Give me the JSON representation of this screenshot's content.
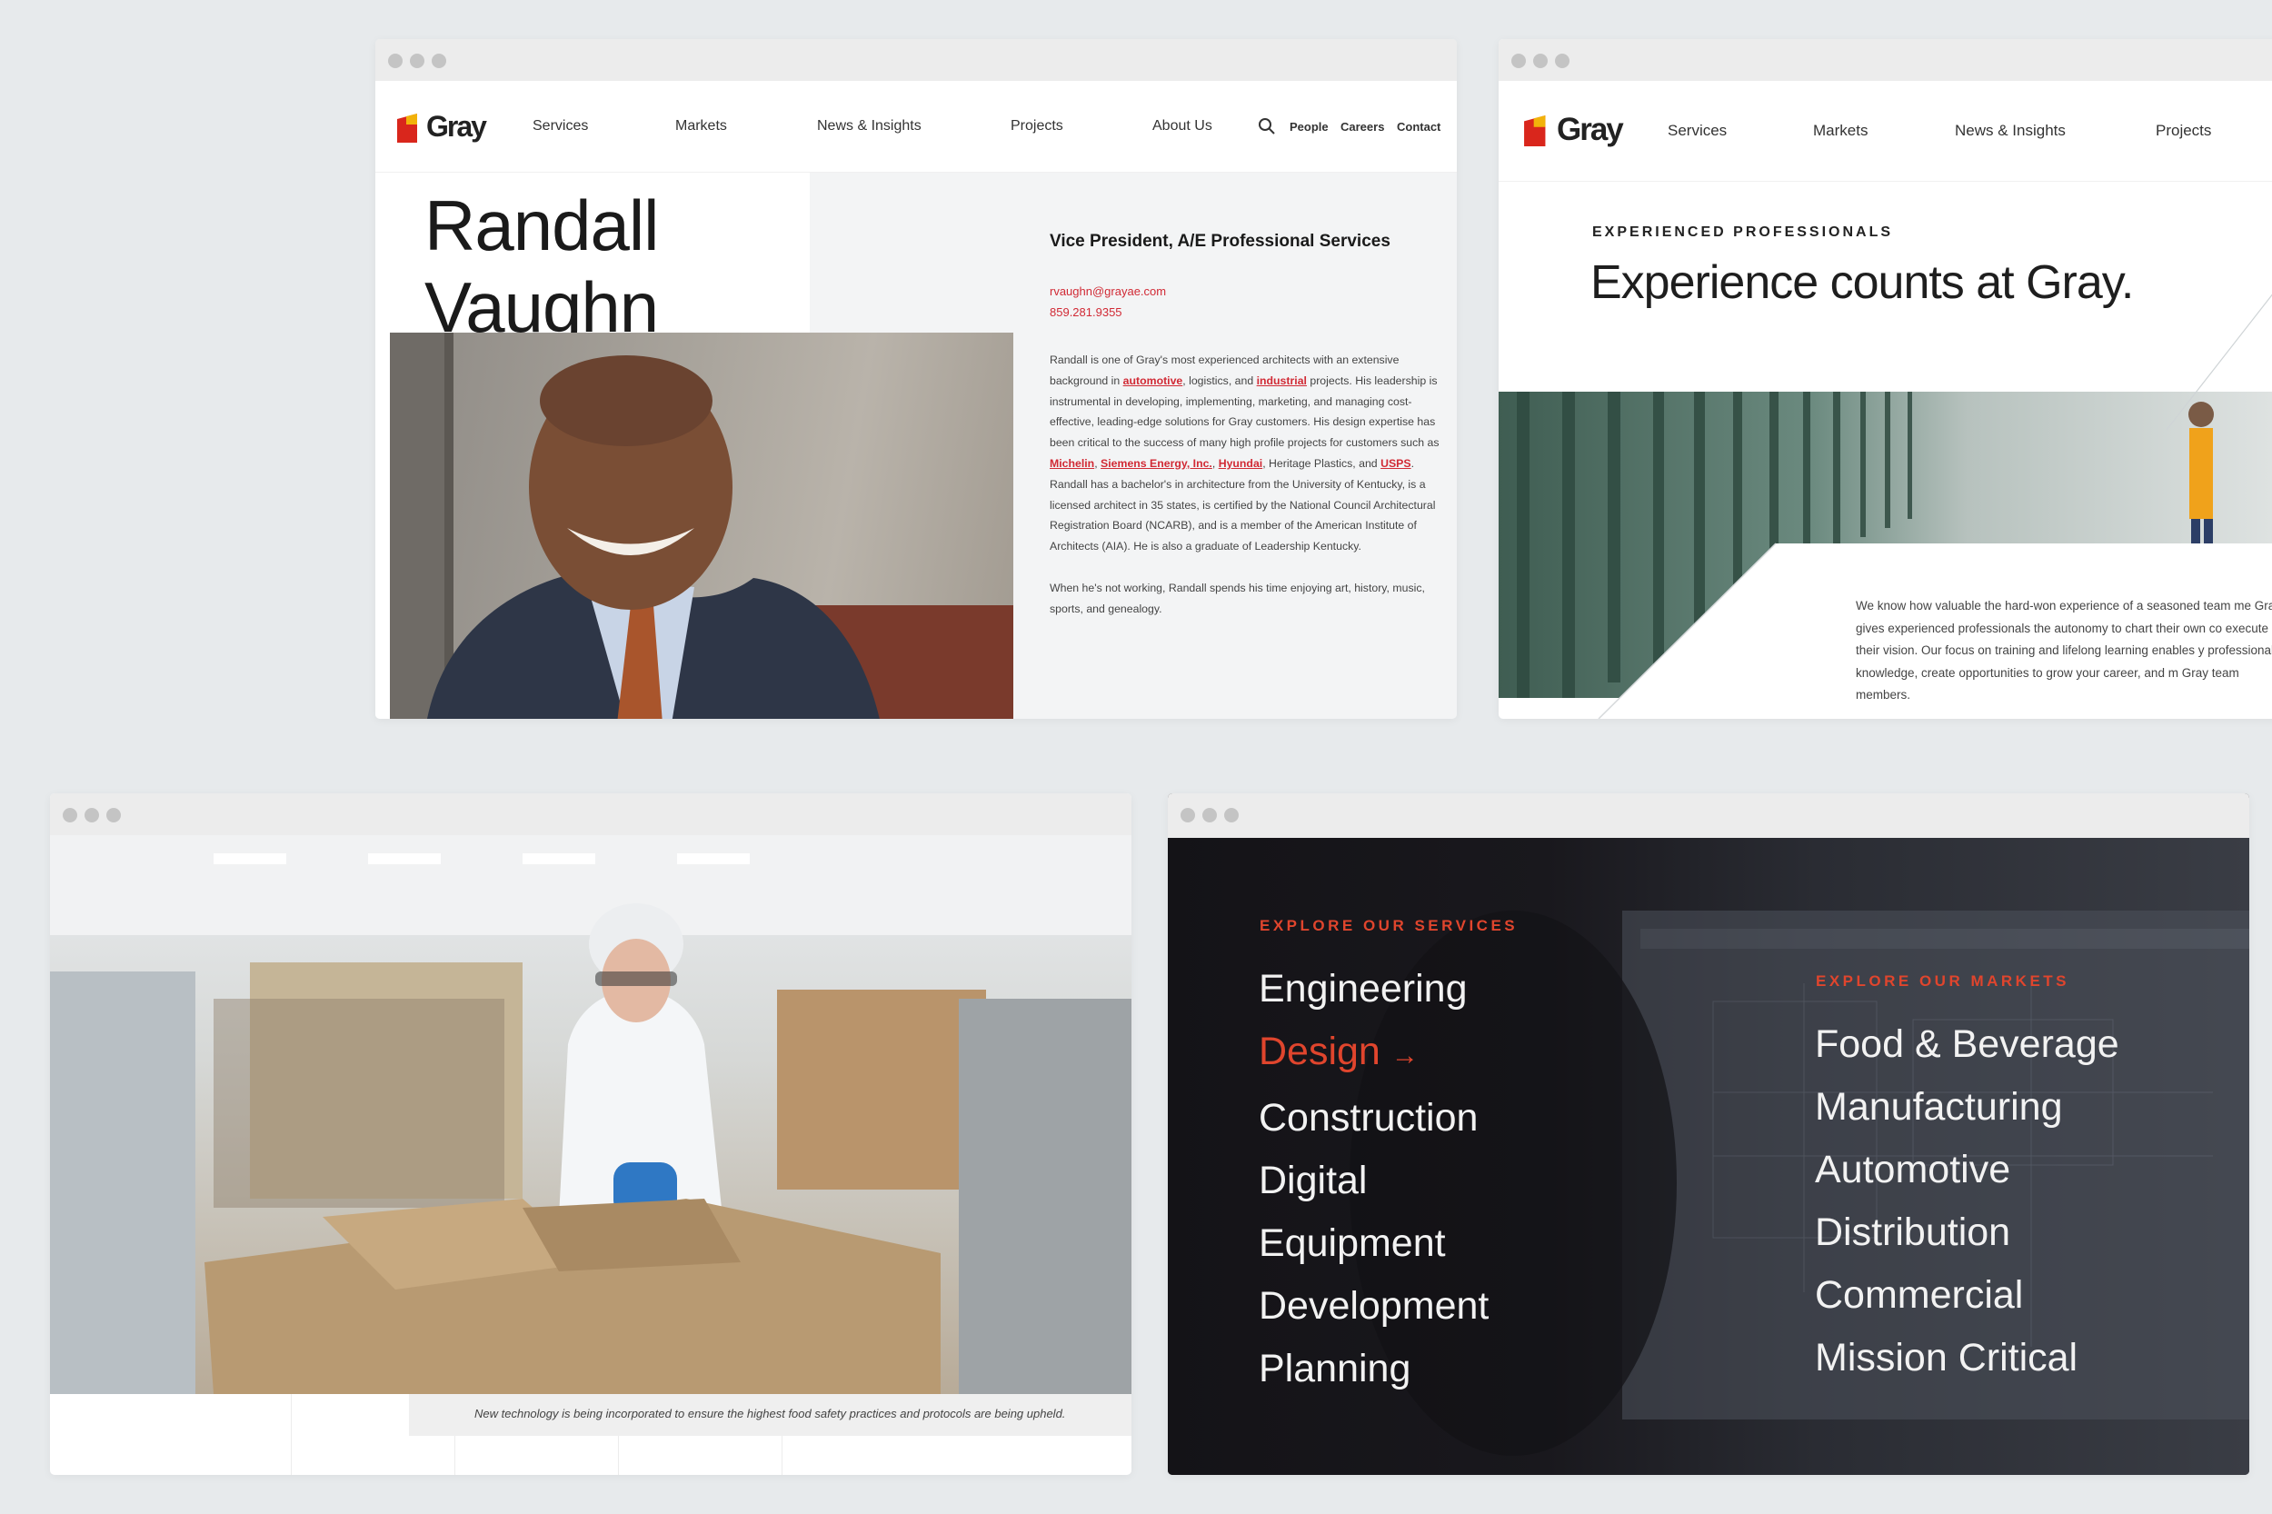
{
  "brand": {
    "logo_text": "Gray",
    "accent": "#d12a35",
    "logo_red": "#d9261c",
    "logo_yellow": "#f2b20a"
  },
  "nav": {
    "services": "Services",
    "markets": "Markets",
    "news": "News & Insights",
    "projects": "Projects",
    "about": "About Us",
    "search_icon": "search-icon",
    "people": "People",
    "careers": "Careers",
    "contact": "Contact"
  },
  "profile": {
    "first_name": "Randall",
    "last_name": "Vaughn",
    "title": "Vice President, A/E Professional Services",
    "email": "rvaughn@grayae.com",
    "phone": "859.281.9355",
    "bio": {
      "p1_a": "Randall is one of Gray's most experienced architects with an extensive background in ",
      "link_automotive": "automotive",
      "p1_b": ", logistics, and ",
      "link_industrial": "industrial",
      "p1_c": " projects. His leadership is instrumental in developing, implementing, marketing, and managing cost-effective, leading-edge solutions for Gray customers. His design expertise has been critical to the success of many high profile projects for customers such as ",
      "link_michelin": "Michelin",
      "sep1": ", ",
      "link_siemens": "Siemens Energy, Inc.",
      "sep2": ", ",
      "link_hyundai": "Hyundai",
      "p1_d": ", Heritage Plastics, and ",
      "link_usps": "USPS",
      "p1_e": ". Randall has a bachelor's in architecture from the University of Kentucky, is a licensed architect in 35 states, is certified by the National Council Architectural Registration Board (NCARB), and is a member of the American Institute of Architects (AIA). He is also a graduate of Leadership Kentucky.",
      "p2": "When he's not working, Randall spends his time enjoying art, history, music, sports, and genealogy."
    }
  },
  "careers_page": {
    "eyebrow": "EXPERIENCED PROFESSIONALS",
    "headline": "Experience counts at Gray.",
    "body": "We know how valuable the hard-won experience of a seasoned team me Gray gives experienced professionals the autonomy to chart their own co execute their vision. Our focus on training and lifelong learning enables y professional knowledge, create opportunities to grow your career, and m Gray team members."
  },
  "food_page": {
    "caption": "New technology is being incorporated to ensure the highest food safety practices and protocols are being upheld."
  },
  "menu": {
    "services_heading": "EXPLORE OUR SERVICES",
    "services": [
      "Engineering",
      "Design",
      "Construction",
      "Digital",
      "Equipment",
      "Development",
      "Planning"
    ],
    "active_arrow": "→",
    "markets_heading": "EXPLORE OUR MARKETS",
    "markets": [
      "Food & Beverage",
      "Manufacturing",
      "Automotive",
      "Distribution",
      "Commercial",
      "Mission Critical"
    ],
    "heading_color": "#e0452d",
    "active_color": "#e0452d"
  }
}
